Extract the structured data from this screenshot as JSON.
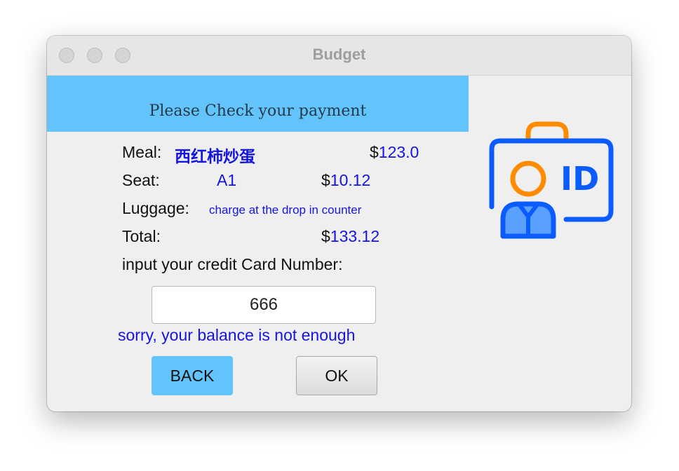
{
  "window": {
    "title": "Budget"
  },
  "header": {
    "banner_text": "Please Check your payment"
  },
  "payment": {
    "meal_label": "Meal:",
    "meal_value": "西红柿炒蛋",
    "meal_currency": "$",
    "meal_price": "123.0",
    "seat_label": "Seat:",
    "seat_value": "A1",
    "seat_currency": "$",
    "seat_price": "10.12",
    "luggage_label": "Luggage:",
    "luggage_value": "charge at the drop in counter",
    "total_label": "Total:",
    "total_currency": "$",
    "total_price": "133.12",
    "card_prompt": "input your credit Card Number:",
    "card_value": "666",
    "error_message": "sorry, your balance is not enough"
  },
  "buttons": {
    "back_label": "BACK",
    "ok_label": "OK"
  },
  "icon": {
    "name": "id-card-icon",
    "text": "ID",
    "colors": {
      "blue": "#0a5cff",
      "orange": "#ff8c00",
      "light_blue": "#5aa0ff"
    }
  },
  "colors": {
    "banner": "#62c4fb",
    "value_text": "#1515e0",
    "back_button": "#62c4fb"
  }
}
